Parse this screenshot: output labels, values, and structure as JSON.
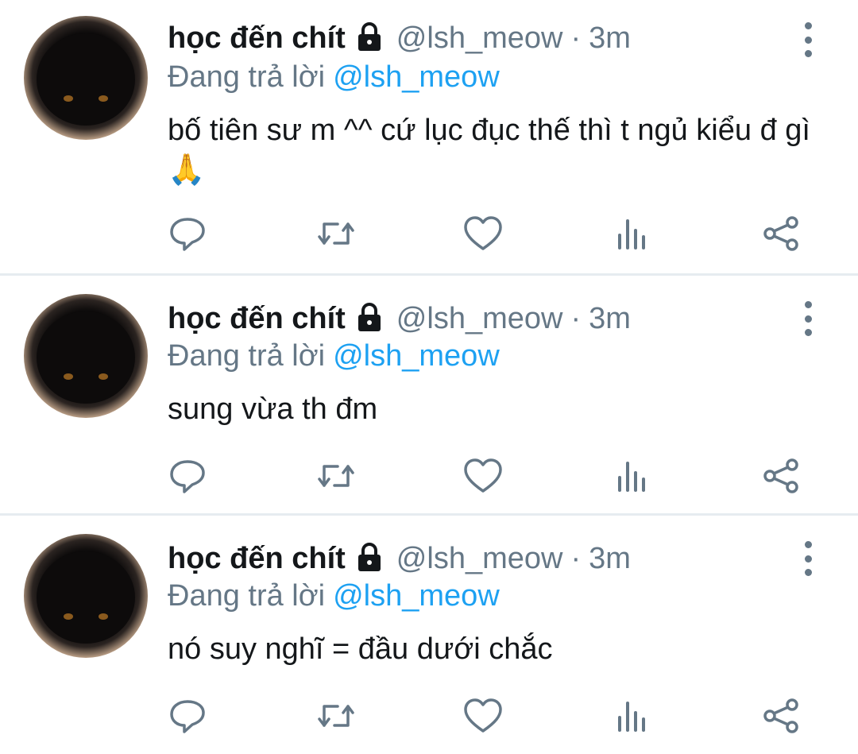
{
  "tweets": [
    {
      "display_name": "học đến chít",
      "handle": "@lsh_meow",
      "separator": "·",
      "time": "3m",
      "replying_prefix": "Đang trả lời",
      "replying_to": "@lsh_meow",
      "text": "bố tiên sư m ^^ cứ lục đục thế thì t ngủ kiểu đ gì 🙏"
    },
    {
      "display_name": "học đến chít",
      "handle": "@lsh_meow",
      "separator": "·",
      "time": "3m",
      "replying_prefix": "Đang trả lời",
      "replying_to": "@lsh_meow",
      "text": "sung vừa th đm"
    },
    {
      "display_name": "học đến chít",
      "handle": "@lsh_meow",
      "separator": "·",
      "time": "3m",
      "replying_prefix": "Đang trả lời",
      "replying_to": "@lsh_meow",
      "text": "nó suy nghĩ = đầu dưới chắc"
    }
  ],
  "icons": {
    "lock": "lock-icon",
    "more": "more-vertical-icon",
    "reply": "reply-icon",
    "retweet": "retweet-icon",
    "like": "heart-icon",
    "analytics": "analytics-icon",
    "share": "share-icon"
  },
  "colors": {
    "name": "#14171a",
    "muted": "#657786",
    "link": "#1da1f2",
    "divider": "#e6ecf0"
  }
}
